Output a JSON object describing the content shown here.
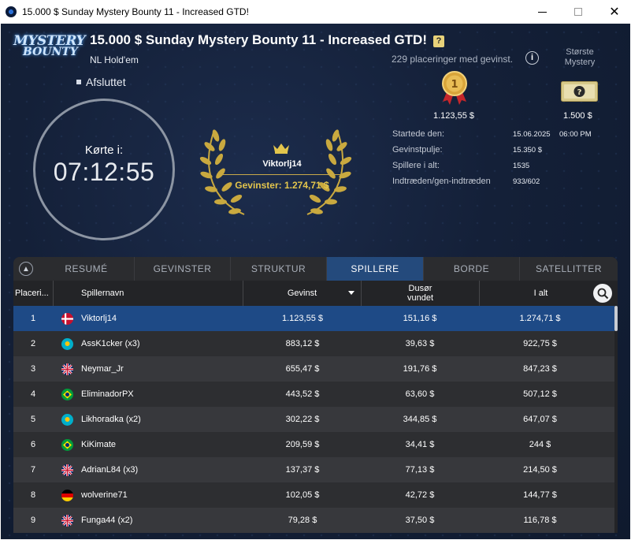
{
  "window": {
    "title": "15.000 $ Sunday Mystery Bounty 11 - Increased GTD!",
    "controls": [
      "—",
      "☐",
      "✕"
    ]
  },
  "logo": {
    "line1": "MYSTERY",
    "line2": "BOUNTY"
  },
  "header": {
    "title": "15.000 $ Sunday Mystery Bounty 11 - Increased GTD!",
    "info_badge": "?",
    "game": "NL Hold'em",
    "status": "Afsluttet"
  },
  "clock": {
    "label": "Kørte i:",
    "time": "07:12:55"
  },
  "winner": {
    "name": "Viktorlj14",
    "prize": "Gevinster: 1.274,71 $"
  },
  "payout": {
    "places_text": "229 placeringer med gevinst.",
    "largest_label_1": "Største",
    "largest_label_2": "Mystery",
    "first_prize": "1.123,55 $",
    "largest_mystery": "1.500 $"
  },
  "stats": {
    "started_label": "Startede den:",
    "started_date": "15.06.2025",
    "started_time": "06:00 PM",
    "prizepool_label": "Gevinstpulje:",
    "prizepool": "15.350 $",
    "players_label": "Spillere i alt:",
    "players": "1535",
    "entries_label": "Indtræden/gen-indtræden",
    "entries": "933/602"
  },
  "tabs": [
    {
      "label": "RESUMÉ",
      "active": false
    },
    {
      "label": "GEVINSTER",
      "active": false
    },
    {
      "label": "STRUKTUR",
      "active": false
    },
    {
      "label": "SPILLERE",
      "active": true
    },
    {
      "label": "BORDE",
      "active": false
    },
    {
      "label": "SATELLITTER",
      "active": false
    }
  ],
  "table": {
    "headers": {
      "place": "Placeri...",
      "name": "Spillernavn",
      "prize": "Gevinst",
      "bounty_1": "Dusør",
      "bounty_2": "vundet",
      "total": "I alt"
    },
    "rows": [
      {
        "pos": "1",
        "flag": "dk",
        "name": "Viktorlj14",
        "prize": "1.123,55 $",
        "bounty": "151,16 $",
        "total": "1.274,71 $"
      },
      {
        "pos": "2",
        "flag": "kz",
        "name": "AssK1cker (x3)",
        "prize": "883,12 $",
        "bounty": "39,63 $",
        "total": "922,75 $"
      },
      {
        "pos": "3",
        "flag": "gb",
        "name": "Neymar_Jr",
        "prize": "655,47 $",
        "bounty": "191,76 $",
        "total": "847,23 $"
      },
      {
        "pos": "4",
        "flag": "br",
        "name": "EliminadorPX",
        "prize": "443,52 $",
        "bounty": "63,60 $",
        "total": "507,12 $"
      },
      {
        "pos": "5",
        "flag": "kz",
        "name": "Likhoradka (x2)",
        "prize": "302,22 $",
        "bounty": "344,85 $",
        "total": "647,07 $"
      },
      {
        "pos": "6",
        "flag": "br",
        "name": "KiKimate",
        "prize": "209,59 $",
        "bounty": "34,41 $",
        "total": "244 $"
      },
      {
        "pos": "7",
        "flag": "gb",
        "name": "AdrianL84 (x3)",
        "prize": "137,37 $",
        "bounty": "77,13 $",
        "total": "214,50 $"
      },
      {
        "pos": "8",
        "flag": "de",
        "name": "wolverine71",
        "prize": "102,05 $",
        "bounty": "42,72 $",
        "total": "144,77 $"
      },
      {
        "pos": "9",
        "flag": "gb",
        "name": "Funga44 (x2)",
        "prize": "79,28 $",
        "bounty": "37,50 $",
        "total": "116,78 $"
      }
    ]
  },
  "colors": {
    "background": "#142038",
    "active_tab": "#244a7c",
    "selected_row": "#1e4a86",
    "gold": "#e3c54c"
  },
  "icons": {
    "collapse": "chevron-up-icon",
    "search": "search-icon",
    "info": "info-icon",
    "medal": "gold-medal-icon",
    "mystery": "mystery-ticket-icon",
    "crown": "crown-icon"
  }
}
